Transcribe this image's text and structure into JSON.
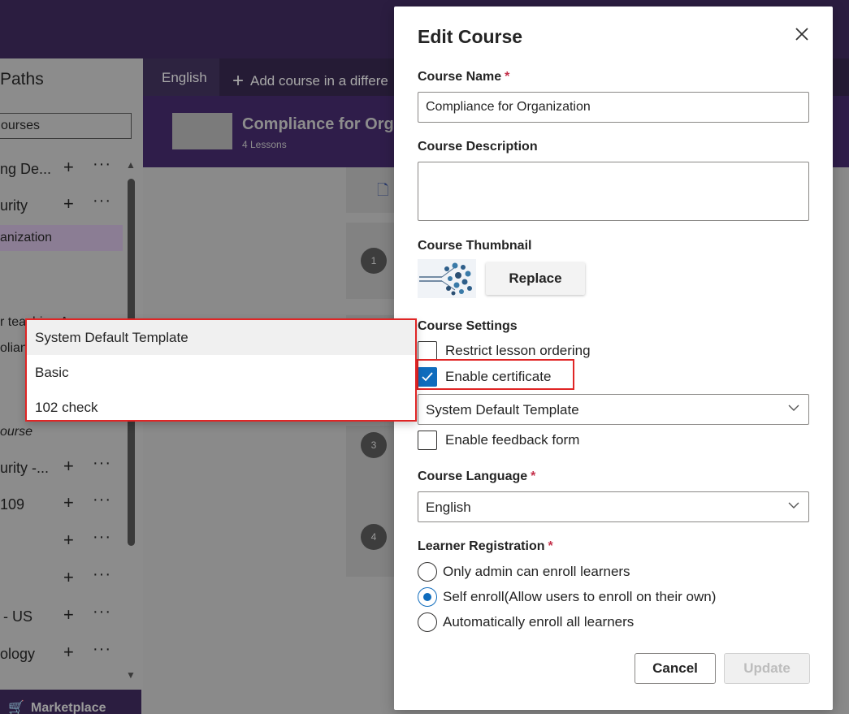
{
  "left_panel": {
    "title": "Paths",
    "search_text": "ourses",
    "rows": [
      {
        "label": "ng De...",
        "has_actions": true
      },
      {
        "label": "urity",
        "has_actions": true
      },
      {
        "label": "anization",
        "has_actions": false,
        "selected": true
      },
      {
        "label": "r teaching A...",
        "has_actions": false
      },
      {
        "label": "olian",
        "has_actions": false
      },
      {
        "label": "ourse",
        "has_actions": false,
        "italic": true
      },
      {
        "label": "urity -...",
        "has_actions": true
      },
      {
        "label": "109",
        "has_actions": true
      },
      {
        "label": "",
        "has_actions": true
      },
      {
        "label": "",
        "has_actions": true
      },
      {
        "label": "- US",
        "has_actions": true
      },
      {
        "label": "ology",
        "has_actions": true
      }
    ],
    "marketplace_label": "Marketplace"
  },
  "lang_bar": {
    "current_language": "English",
    "add_label": "Add course in a differe"
  },
  "course_header": {
    "title": "Compliance for Orga",
    "lessons": "4 Lessons"
  },
  "lesson_numbers": [
    "1",
    "3",
    "4"
  ],
  "dialog": {
    "title": "Edit Course",
    "course_name_label": "Course Name",
    "course_name_value": "Compliance for Organization",
    "course_description_label": "Course Description",
    "course_description_value": "",
    "course_thumbnail_label": "Course Thumbnail",
    "replace_label": "Replace",
    "course_settings_label": "Course Settings",
    "restrict_label": "Restrict lesson ordering",
    "restrict_checked": false,
    "certificate_label": "Enable certificate",
    "certificate_checked": true,
    "template_selected": "System Default Template",
    "feedback_label": "Enable feedback form",
    "feedback_checked": false,
    "language_label": "Course Language",
    "language_value": "English",
    "registration_label": "Learner Registration",
    "registration_options": [
      {
        "label": "Only admin can enroll learners",
        "selected": false
      },
      {
        "label": "Self enroll(Allow users to enroll on their own)",
        "selected": true
      },
      {
        "label": "Automatically enroll all learners",
        "selected": false
      }
    ],
    "cancel_label": "Cancel",
    "update_label": "Update",
    "required_mark": "*"
  },
  "template_dropdown": {
    "options": [
      "System Default Template",
      "Basic",
      "102 check"
    ],
    "highlighted_index": 0
  },
  "colors": {
    "accent": "#0f6cbd",
    "highlight_border": "#e02525",
    "topbar": "#2b1d40",
    "required": "#c4314b"
  }
}
